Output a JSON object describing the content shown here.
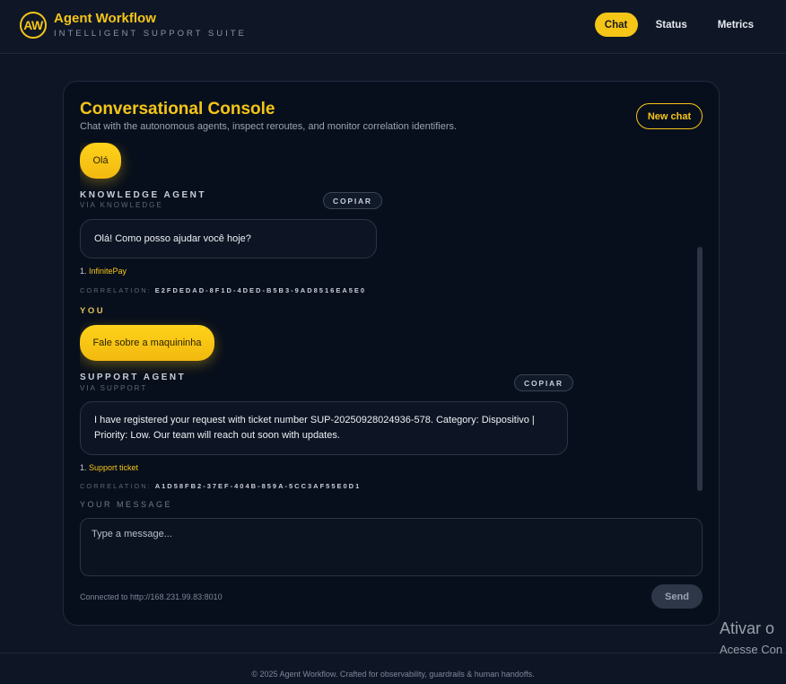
{
  "header": {
    "logo": "AW",
    "title": "Agent Workflow",
    "subtitle": "INTELLIGENT SUPPORT SUITE",
    "nav": [
      "Chat",
      "Status",
      "Metrics"
    ]
  },
  "console": {
    "title": "Conversational Console",
    "subtitle": "Chat with the autonomous agents, inspect reroutes, and monitor correlation identifiers.",
    "new_chat": "New chat"
  },
  "messages": [
    {
      "role": "user",
      "text": "Olá"
    },
    {
      "role": "agent",
      "agent": "KNOWLEDGE AGENT",
      "via": "VIA KNOWLEDGE",
      "copy": "COPIAR",
      "text": "Olá! Como posso ajudar você hoje?",
      "source_num": "1.",
      "source": "InfinitePay",
      "correlation_label": "CORRELATION:",
      "correlation": "E2FDEDAD-8F1D-4DED-B5B3-9AD8516EA5E0"
    },
    {
      "role": "user",
      "label": "YOU",
      "text": "Fale sobre a maquininha"
    },
    {
      "role": "agent",
      "agent": "SUPPORT AGENT",
      "via": "VIA SUPPORT",
      "copy": "COPIAR",
      "text": "I have registered your request with ticket number SUP-20250928024936-578. Category: Dispositivo | Priority: Low. Our team will reach out soon with updates.",
      "source_num": "1.",
      "source": "Support ticket",
      "correlation_label": "CORRELATION:",
      "correlation": "A1D58FB2-37EF-404B-859A-5CC3AF55E0D1"
    }
  ],
  "composer": {
    "label": "YOUR MESSAGE",
    "placeholder": "Type a message...",
    "connected": "Connected to http://168.231.99.83:8010",
    "send": "Send"
  },
  "footer": "© 2025 Agent Workflow. Crafted for observability, guardrails & human handoffs.",
  "watermark": {
    "line1": "Ativar o",
    "line2": "Acesse Con"
  },
  "colors": {
    "accent": "#f5c518",
    "background": "#0e1626",
    "card": "#080f1c"
  }
}
